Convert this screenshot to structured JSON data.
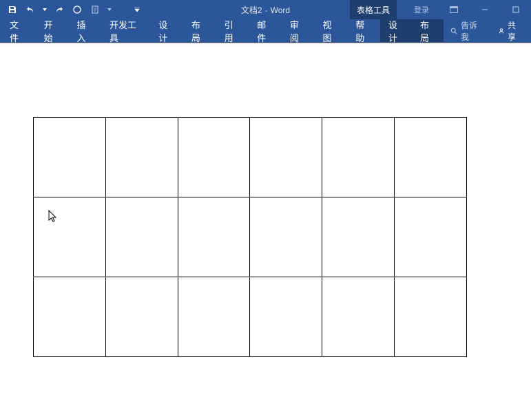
{
  "title": {
    "doc_name": "文档2",
    "app_name": "Word"
  },
  "qat": {
    "save": "save-icon",
    "undo": "undo-icon",
    "redo": "redo-icon",
    "circle": "circle-icon",
    "page": "page-icon"
  },
  "contextual_tab": "表格工具",
  "login": "登录",
  "window_controls": {
    "ribbon_opts": "⛶",
    "minimize": "—",
    "restore": "▢"
  },
  "ribbon": {
    "tabs": [
      "文件",
      "开始",
      "插入",
      "开发工具",
      "设计",
      "布局",
      "引用",
      "邮件",
      "审阅",
      "视图",
      "帮助"
    ],
    "context_tabs": [
      "设计",
      "布局"
    ],
    "tell_me_placeholder": "告诉我",
    "share": "共享"
  },
  "table": {
    "rows": 3,
    "cols": 6
  }
}
